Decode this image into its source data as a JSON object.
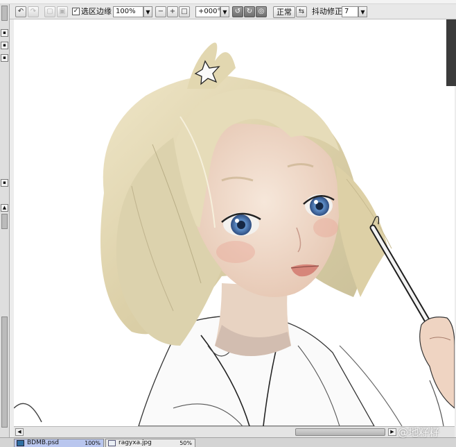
{
  "menu": {
    "items": [
      "",
      "",
      "",
      "",
      "",
      ""
    ]
  },
  "toolbar": {
    "selection_edge_label": "选区边缘",
    "selection_edge_checked": true,
    "zoom_value": "100%",
    "rotation_value": "+000°",
    "blend_mode_label": "正常",
    "stabilizer_label": "抖动修正",
    "stabilizer_value": "7"
  },
  "icons": {
    "undo": "undo-icon",
    "redo": "redo-icon",
    "zoom_out": "minus-icon",
    "zoom_in": "plus-icon",
    "zoom_reset": "zoom-fit-icon",
    "rotate_ccw": "rotate-left-icon",
    "rotate_cw": "rotate-right-icon",
    "rotate_reset": "rotate-reset-icon",
    "flip": "flip-horizontal-icon"
  },
  "tabs": [
    {
      "filename": "BDMB.psd",
      "zoom": "100%",
      "active": true
    },
    {
      "filename": "ragyxa.jpg",
      "zoom": "50%",
      "active": false
    }
  ],
  "watermark": "@地籽籽",
  "colors": {
    "active_tab": "#b9c6ee",
    "hair": "#e4d8b2",
    "skin": "#f1ddcd",
    "eyes": "#5f8fc8"
  }
}
